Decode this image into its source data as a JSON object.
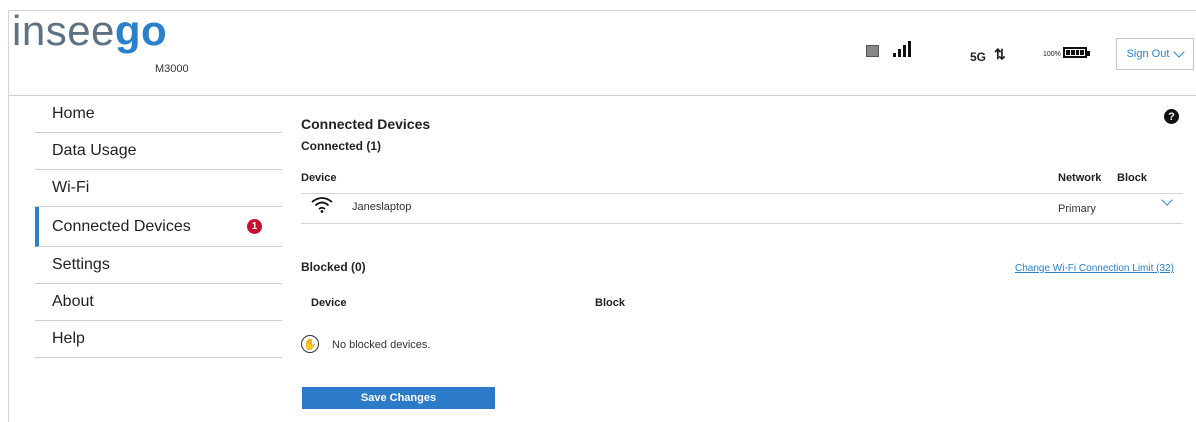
{
  "header": {
    "logo_prefix": "insee",
    "logo_suffix": "go",
    "model": "M3000",
    "network_type": "5G",
    "transfer_icon": "⇅",
    "battery_percent": "100%",
    "sign_out_label": "Sign Out"
  },
  "sidebar": {
    "items": [
      {
        "label": "Home"
      },
      {
        "label": "Data Usage"
      },
      {
        "label": "Wi-Fi"
      },
      {
        "label": "Connected Devices",
        "badge": "1"
      },
      {
        "label": "Settings"
      },
      {
        "label": "About"
      },
      {
        "label": "Help"
      }
    ]
  },
  "main": {
    "title": "Connected Devices",
    "help_icon": "?",
    "connected": {
      "heading": "Connected (1)",
      "columns": {
        "device": "Device",
        "network": "Network",
        "block": "Block"
      },
      "rows": [
        {
          "device": "Janeslaptop",
          "network": "Primary"
        }
      ],
      "limit_link": "Change Wi-Fi Connection Limit (32)"
    },
    "blocked": {
      "heading": "Blocked (0)",
      "columns": {
        "device": "Device",
        "block": "Block"
      },
      "empty_text": "No blocked devices."
    },
    "save_label": "Save Changes"
  },
  "colors": {
    "accent": "#2b81c9",
    "badge": "#c8102e",
    "logo_gray": "#5e7282"
  }
}
